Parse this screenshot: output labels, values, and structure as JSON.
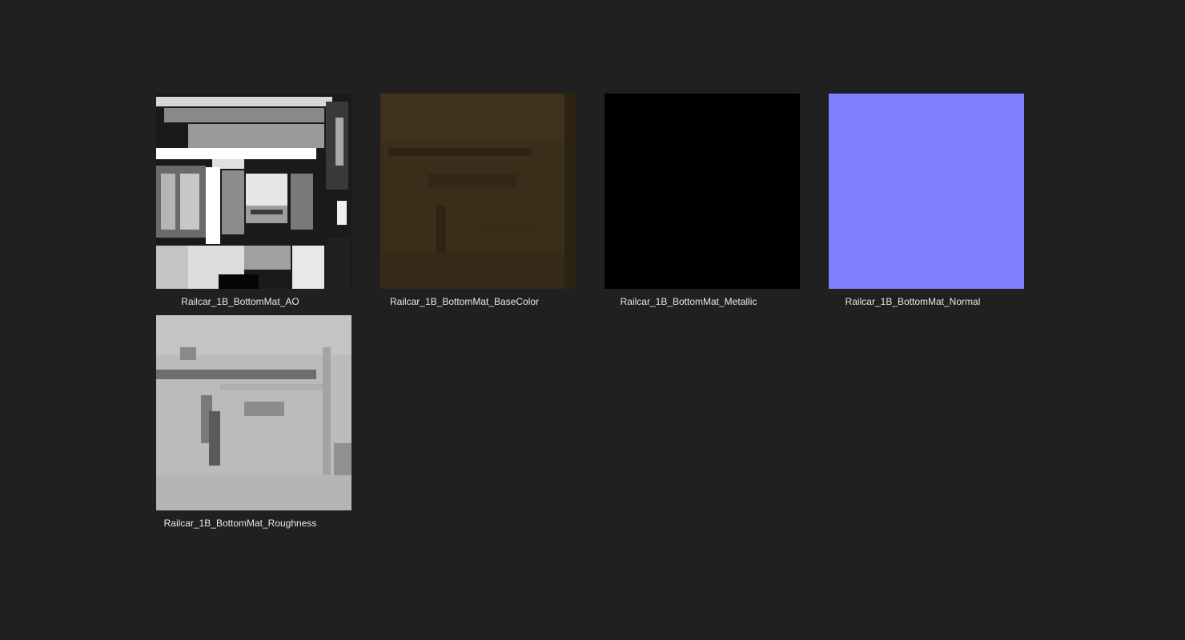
{
  "files": [
    {
      "name": "Railcar_1B_BottomMat_AO",
      "thumbnail_icon": "ao-texture-thumbnail",
      "dominant_color": "#bdbdbd"
    },
    {
      "name": "Railcar_1B_BottomMat_BaseColor",
      "thumbnail_icon": "basecolor-texture-thumbnail",
      "dominant_color": "#3a2d1a"
    },
    {
      "name": "Railcar_1B_BottomMat_Metallic",
      "thumbnail_icon": "metallic-texture-thumbnail",
      "dominant_color": "#000000"
    },
    {
      "name": "Railcar_1B_BottomMat_Normal",
      "thumbnail_icon": "normal-texture-thumbnail",
      "dominant_color": "#8080ff"
    },
    {
      "name": "Railcar_1B_BottomMat_Roughness",
      "thumbnail_icon": "roughness-texture-thumbnail",
      "dominant_color": "#bbbbbb"
    }
  ],
  "colors": {
    "background": "#202020",
    "label_text": "#e8e8e8"
  }
}
